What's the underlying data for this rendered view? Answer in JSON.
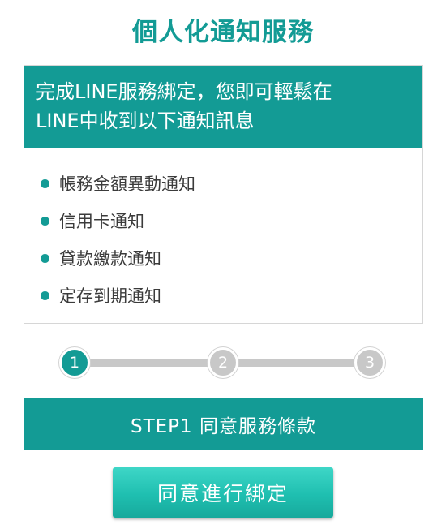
{
  "page_title": "個人化通知服務",
  "info_card": {
    "header_line1": "完成LINE服務綁定，您即可輕鬆在",
    "header_line2": "LINE中收到以下通知訊息",
    "items": [
      "帳務金額異動通知",
      "信用卡通知",
      "貸款繳款通知",
      "定存到期通知"
    ]
  },
  "stepper": {
    "steps": [
      "1",
      "2",
      "3"
    ],
    "current_step": 1
  },
  "step_banner": "STEP1 同意服務條款",
  "bind_button_label": "同意進行綁定",
  "colors": {
    "accent": "#139b95",
    "button": "#1fbfb0",
    "inactive_step": "#c8c8c8"
  }
}
